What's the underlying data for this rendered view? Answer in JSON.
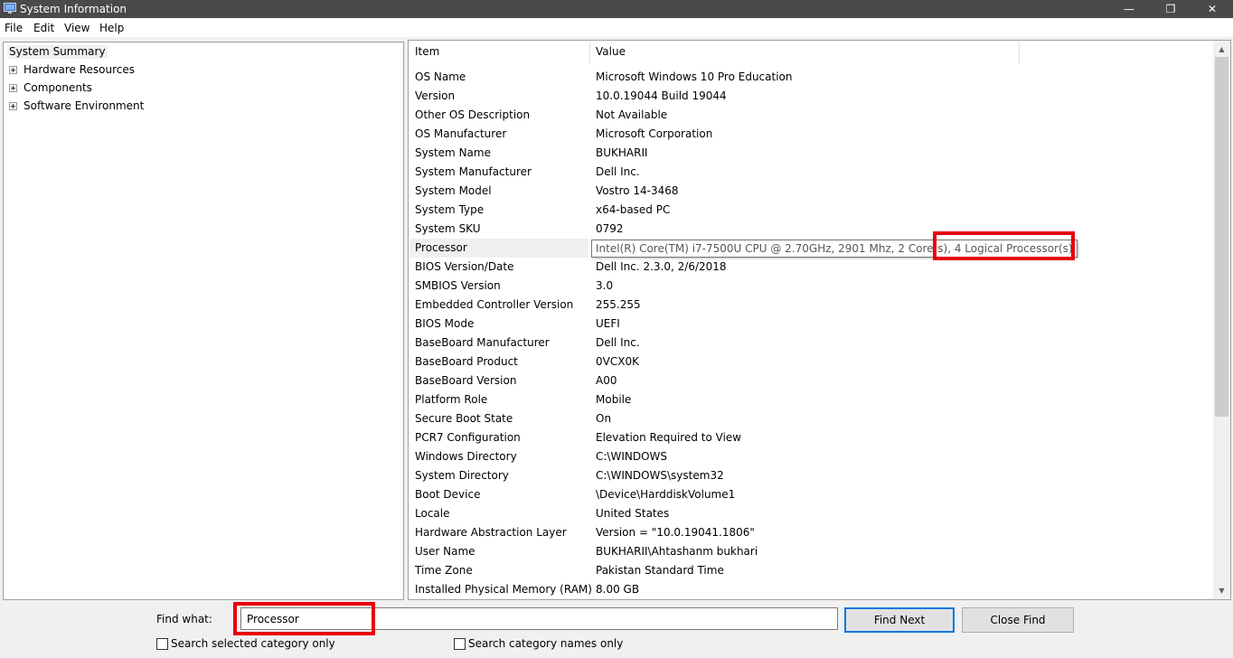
{
  "window": {
    "title": "System Information",
    "controls": {
      "minimize": "—",
      "maximize": "❐",
      "close": "✕"
    }
  },
  "menu": [
    "File",
    "Edit",
    "View",
    "Help"
  ],
  "tree": {
    "root": "System Summary",
    "nodes": [
      "Hardware Resources",
      "Components",
      "Software Environment"
    ]
  },
  "list": {
    "headers": {
      "item": "Item",
      "value": "Value"
    },
    "rows": [
      {
        "item": "OS Name",
        "value": "Microsoft Windows 10 Pro Education"
      },
      {
        "item": "Version",
        "value": "10.0.19044 Build 19044"
      },
      {
        "item": "Other OS Description",
        "value": "Not Available"
      },
      {
        "item": "OS Manufacturer",
        "value": "Microsoft Corporation"
      },
      {
        "item": "System Name",
        "value": "BUKHARII"
      },
      {
        "item": "System Manufacturer",
        "value": "Dell Inc."
      },
      {
        "item": "System Model",
        "value": "Vostro 14-3468"
      },
      {
        "item": "System Type",
        "value": "x64-based PC"
      },
      {
        "item": "System SKU",
        "value": "0792"
      },
      {
        "item": "Processor",
        "value": "Intel(R) Core(TM) i7-7500U CPU @ 2.70GHz, 2901 Mhz, 2 Core(s), 4 Logical Processor(s)"
      },
      {
        "item": "BIOS Version/Date",
        "value": "Dell Inc. 2.3.0, 2/6/2018"
      },
      {
        "item": "SMBIOS Version",
        "value": "3.0"
      },
      {
        "item": "Embedded Controller Version",
        "value": "255.255"
      },
      {
        "item": "BIOS Mode",
        "value": "UEFI"
      },
      {
        "item": "BaseBoard Manufacturer",
        "value": "Dell Inc."
      },
      {
        "item": "BaseBoard Product",
        "value": "0VCX0K"
      },
      {
        "item": "BaseBoard Version",
        "value": "A00"
      },
      {
        "item": "Platform Role",
        "value": "Mobile"
      },
      {
        "item": "Secure Boot State",
        "value": "On"
      },
      {
        "item": "PCR7 Configuration",
        "value": "Elevation Required to View"
      },
      {
        "item": "Windows Directory",
        "value": "C:\\WINDOWS"
      },
      {
        "item": "System Directory",
        "value": "C:\\WINDOWS\\system32"
      },
      {
        "item": "Boot Device",
        "value": "\\Device\\HarddiskVolume1"
      },
      {
        "item": "Locale",
        "value": "United States"
      },
      {
        "item": "Hardware Abstraction Layer",
        "value": "Version = \"10.0.19041.1806\""
      },
      {
        "item": "User Name",
        "value": "BUKHARII\\Ahtashanm bukhari"
      },
      {
        "item": "Time Zone",
        "value": "Pakistan Standard Time"
      },
      {
        "item": "Installed Physical Memory (RAM)",
        "value": "8.00 GB"
      }
    ],
    "selected_index": 9
  },
  "find": {
    "label": "Find what:",
    "value": "Processor",
    "find_next": "Find Next",
    "close_find": "Close Find",
    "search_selected_only": "Search selected category only",
    "search_names_only": "Search category names only"
  },
  "colors": {
    "titlebar": "#4a4a4a",
    "highlight": "#e8000b",
    "accent_button": "#0078d7"
  }
}
